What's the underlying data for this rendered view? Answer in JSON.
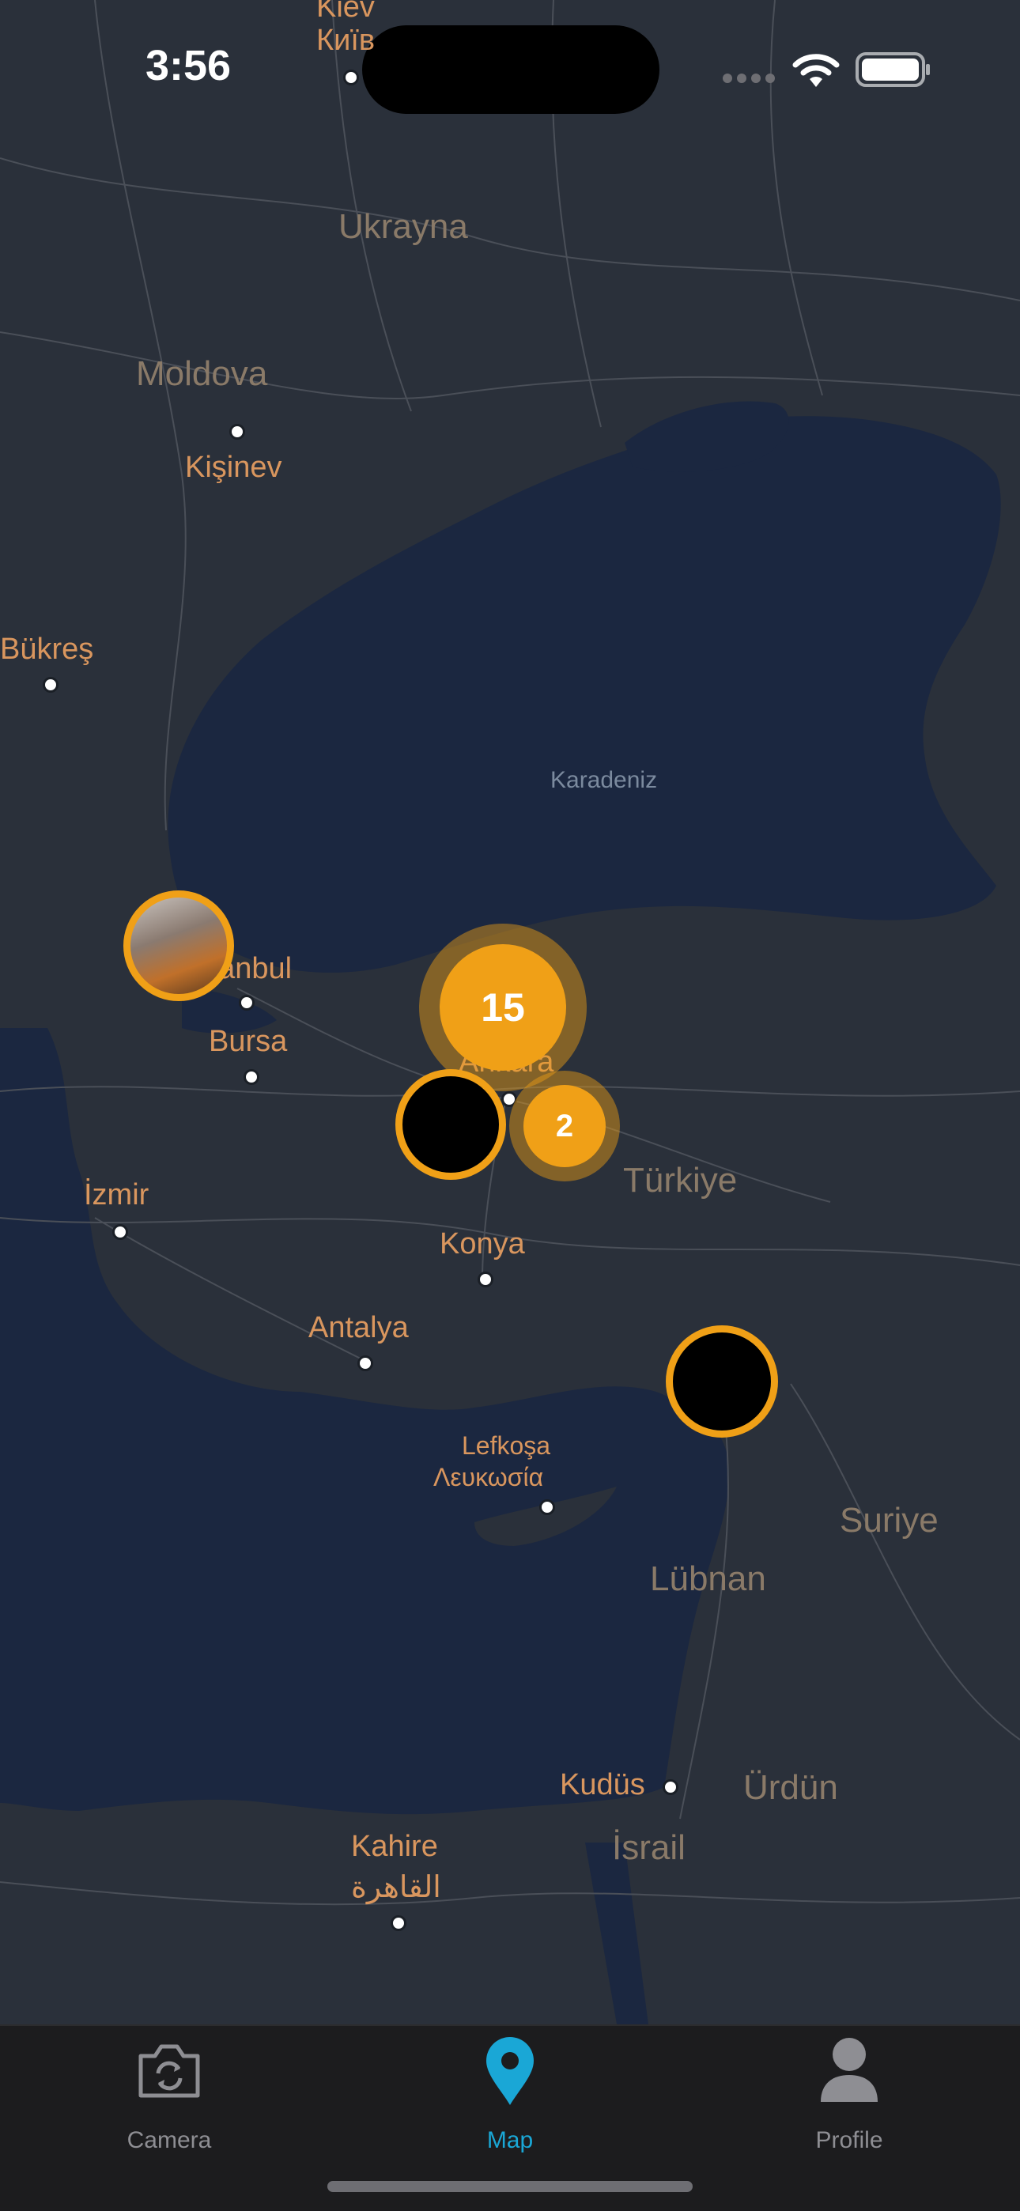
{
  "status_bar": {
    "time": "3:56"
  },
  "map": {
    "countries": {
      "ukraine": "Ukrayna",
      "moldova": "Moldova",
      "turkey": "Türkiye",
      "syria": "Suriye",
      "lebanon": "Lübnan",
      "jordan": "Ürdün",
      "israel": "İsrail"
    },
    "cities": {
      "kiev_latin": "Kiev",
      "kiev_cyrillic": "Київ",
      "chisinau": "Kişinev",
      "bucharest": "Bükreş",
      "istanbul": "İstanbul",
      "bursa": "Bursa",
      "ankara": "Ankara",
      "izmir": "İzmir",
      "konya": "Konya",
      "antalya": "Antalya",
      "nicosia_tr": "Lefkoşa",
      "nicosia_gr": "Λευκωσία",
      "jerusalem": "Kudüs",
      "cairo_latin": "Kahire",
      "cairo_arabic": "القاهرة"
    },
    "seas": {
      "black_sea": "Karadeniz"
    },
    "clusters": {
      "ankara_count": "15",
      "east_count": "2"
    }
  },
  "tab_bar": {
    "camera_label": "Camera",
    "map_label": "Map",
    "profile_label": "Profile",
    "active_color": "#1aa7d6",
    "inactive_color": "#8e8e93"
  },
  "colors": {
    "marker": "#f0a017",
    "map_land": "#2a303a",
    "map_sea": "#1b2740"
  }
}
